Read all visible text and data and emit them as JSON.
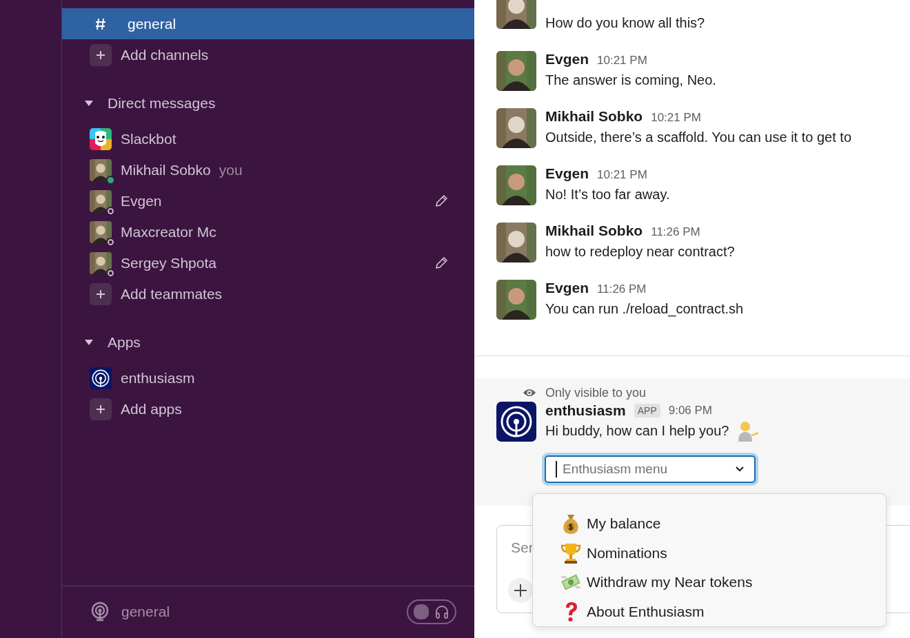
{
  "sidebar": {
    "channels": [
      {
        "name": "general",
        "selected": true
      }
    ],
    "add_channels": "Add channels",
    "sections": [
      {
        "title": "Direct messages",
        "expanded": true,
        "add_label": "Add teammates",
        "items": [
          {
            "kind": "bot",
            "name": "Slackbot",
            "draft": false
          },
          {
            "kind": "user",
            "name": "Mikhail Sobko",
            "note": "you",
            "online": true,
            "draft": false
          },
          {
            "kind": "user",
            "name": "Evgen",
            "online": false,
            "draft": true
          },
          {
            "kind": "user",
            "name": "Maxcreator Mc",
            "online": false,
            "draft": false
          },
          {
            "kind": "user",
            "name": "Sergey Shpota",
            "online": false,
            "draft": true
          }
        ]
      },
      {
        "title": "Apps",
        "expanded": true,
        "add_label": "Add apps",
        "items": [
          {
            "kind": "app",
            "name": "enthusiasm",
            "draft": false
          }
        ]
      }
    ],
    "footer": {
      "channel": "general",
      "huddle_on": false
    }
  },
  "messages": [
    {
      "text": "How do you know all this?"
    },
    {
      "sender": "Evgen",
      "time": "10:21 PM",
      "text": "The answer is coming, Neo."
    },
    {
      "sender": "Mikhail Sobko",
      "time": "10:21 PM",
      "text": "Outside, there’s a scaffold. You can use it to get to"
    },
    {
      "sender": "Evgen",
      "time": "10:21 PM",
      "text": "No! It’s too far away."
    },
    {
      "sender": "Mikhail Sobko",
      "time": "11:26 PM",
      "text": "how to redeploy near contract?"
    },
    {
      "sender": "Evgen",
      "time": "11:26 PM",
      "text": "You can run ./reload_contract.sh"
    }
  ],
  "ephemeral": {
    "notice": "Only visible to you",
    "sender": "enthusiasm",
    "badge": "APP",
    "time": "9:06 PM",
    "text": "Hi buddy, how can I help you?",
    "select": {
      "placeholder": "Enthusiasm menu",
      "open": true,
      "options": [
        {
          "kind": "money-bag",
          "label": "My balance"
        },
        {
          "kind": "trophy",
          "label": "Nominations"
        },
        {
          "kind": "money-wings",
          "label": "Withdraw my Near tokens"
        },
        {
          "kind": "question",
          "label": "About Enthusiasm"
        }
      ]
    }
  },
  "composer": {
    "placeholder": "Ser"
  }
}
